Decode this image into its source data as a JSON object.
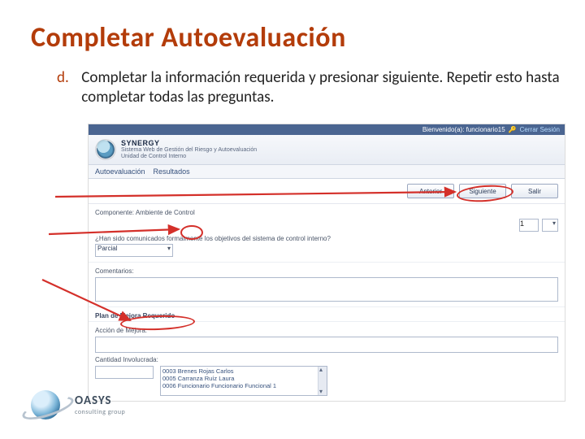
{
  "slide": {
    "title": "Completar Autoevaluación",
    "step_marker": "d.",
    "step_text": "Completar la información requerida y presionar siguiente. Repetir esto hasta completar todas las preguntas."
  },
  "app": {
    "topbar": {
      "welcome": "Bienvenido(a): funcionario15",
      "logout": "Cerrar Sesión"
    },
    "brand": {
      "name": "SYNERGY",
      "line1": "Sistema Web de Gestión del Riesgo y Autoevaluación",
      "line2": "Unidad de Control Interno"
    },
    "menu": {
      "item1": "Autoevaluación",
      "item2": "Resultados"
    },
    "buttons": {
      "prev": "Anterior",
      "next": "Siguiente",
      "exit": "Salir"
    },
    "component_label": "Componente: Ambiente de Control",
    "question": "¿Han sido comunicados formalmente los objetivos del sistema de control interno?",
    "answer_label": "Parcial",
    "page_index": "1",
    "comments_label": "Comentarios:",
    "plan_label": "Plan de Mejora Requerido",
    "action_label": "Acción de Mejora:",
    "involved_label": "Cantidad Involucrada:",
    "people": {
      "p1": "0003 Brenes Rojas Carlos",
      "p2": "0005 Carranza Ruíz Laura",
      "p3": "0006 Funcionario Funcionario Funcional 1"
    }
  },
  "footer": {
    "brand": "OASYS",
    "tag": "consulting group"
  }
}
